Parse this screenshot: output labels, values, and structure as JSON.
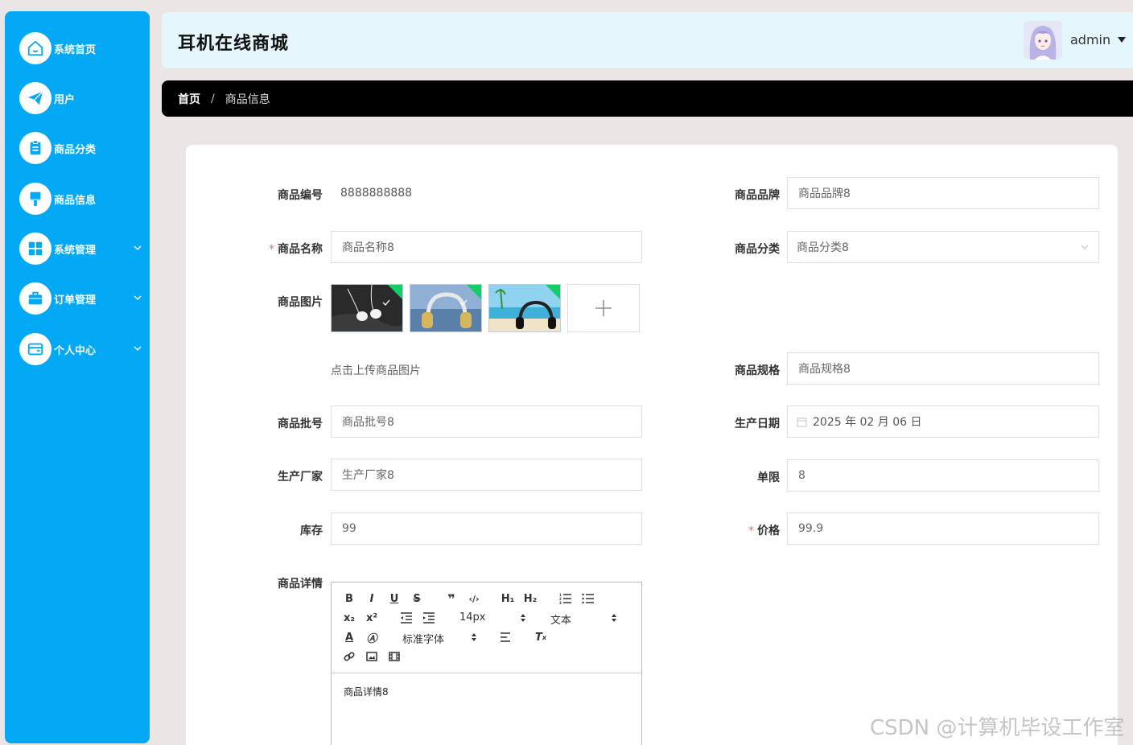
{
  "sidebar": {
    "items": [
      {
        "label": "系统首页",
        "icon": "home-icon"
      },
      {
        "label": "用户",
        "icon": "paper-plane-icon"
      },
      {
        "label": "商品分类",
        "icon": "clipboard-icon"
      },
      {
        "label": "商品信息",
        "icon": "brush-icon"
      },
      {
        "label": "系统管理",
        "icon": "grid-icon",
        "expandable": true
      },
      {
        "label": "订单管理",
        "icon": "briefcase-icon",
        "expandable": true
      },
      {
        "label": "个人中心",
        "icon": "wallet-icon",
        "expandable": true
      }
    ]
  },
  "header": {
    "title": "耳机在线商城",
    "user": "admin"
  },
  "breadcrumb": {
    "home": "首页",
    "separator": "/",
    "current": "商品信息"
  },
  "form": {
    "code": {
      "label": "商品编号",
      "value": "8888888888"
    },
    "brand": {
      "label": "商品品牌",
      "value": "商品品牌8"
    },
    "name": {
      "label": "商品名称",
      "value": "商品名称8",
      "required": "*"
    },
    "category": {
      "label": "商品分类",
      "value": "商品分类8"
    },
    "images": {
      "label": "商品图片",
      "hint": "点击上传商品图片",
      "count": 3
    },
    "spec": {
      "label": "商品规格",
      "value": "商品规格8"
    },
    "batch": {
      "label": "商品批号",
      "value": "商品批号8"
    },
    "production_date": {
      "label": "生产日期",
      "value": "2025 年 02 月 06 日"
    },
    "manufacturer": {
      "label": "生产厂家",
      "value": "生产厂家8"
    },
    "limit": {
      "label": "单限",
      "value": "8"
    },
    "stock": {
      "label": "库存",
      "value": "99"
    },
    "price": {
      "label": "价格",
      "value": "99.9",
      "required": "*"
    },
    "details": {
      "label": "商品详情",
      "content": "商品详情8",
      "toolbar": {
        "size": "14px",
        "header": "文本",
        "font": "标准字体"
      }
    }
  },
  "watermark": "CSDN @计算机毕设工作室",
  "colors": {
    "sidebar": "#03a9f4",
    "header_bg": "#e5f6fd",
    "breadcrumb_bg": "#000000",
    "page_bg": "#ebe5e5",
    "required": "#f56c6c"
  }
}
